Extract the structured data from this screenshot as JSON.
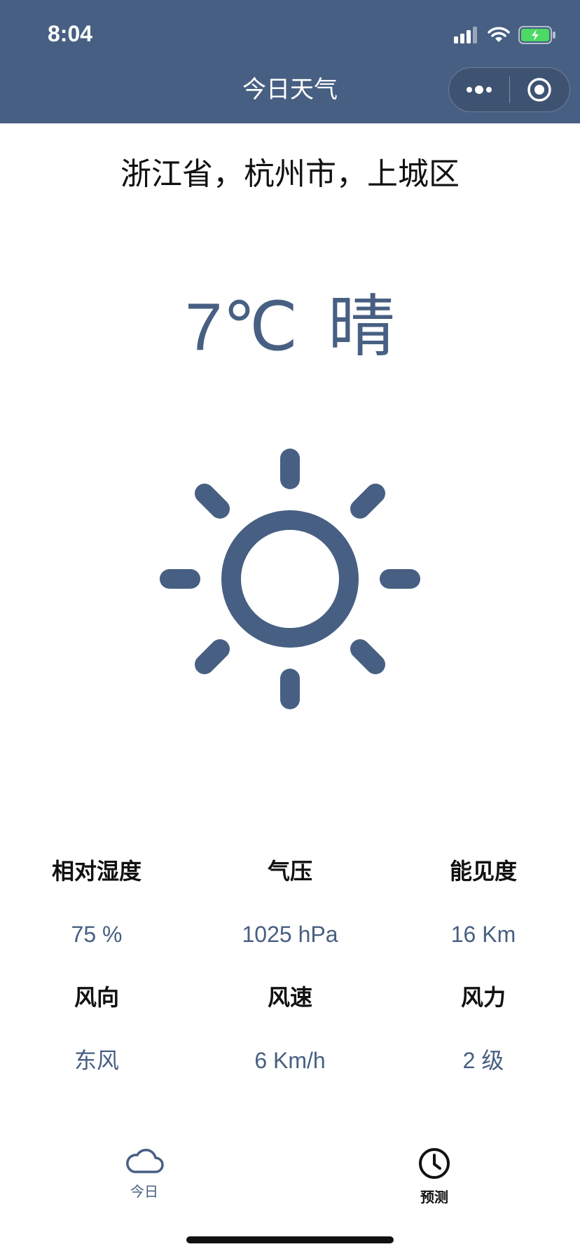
{
  "status_bar": {
    "time": "8:04"
  },
  "nav": {
    "title": "今日天气"
  },
  "location": "浙江省，杭州市，上城区",
  "weather": {
    "temperature": "7℃",
    "condition": "晴",
    "icon": "sun-icon"
  },
  "stats": [
    {
      "label": "相对湿度",
      "value": "75 %"
    },
    {
      "label": "气压",
      "value": "1025 hPa"
    },
    {
      "label": "能见度",
      "value": "16 Km"
    },
    {
      "label": "风向",
      "value": "东风"
    },
    {
      "label": "风速",
      "value": "6 Km/h"
    },
    {
      "label": "风力",
      "value": "2 级"
    }
  ],
  "tabs": [
    {
      "label": "今日",
      "icon": "cloud-icon",
      "active": true
    },
    {
      "label": "预测",
      "icon": "clock-icon",
      "active": false
    }
  ],
  "colors": {
    "primary": "#475f82",
    "battery": "#4cd964"
  }
}
